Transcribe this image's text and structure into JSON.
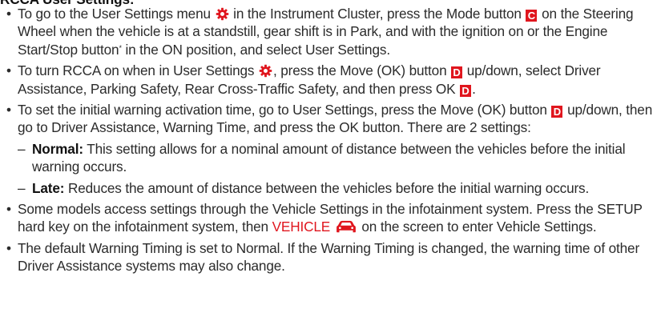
{
  "section": {
    "heading": "RCCA User Settings:"
  },
  "icons": {
    "accent_color": "#e0161e",
    "settings": "gear-icon",
    "vehicle": "car-icon"
  },
  "bullets": {
    "b1": {
      "p1": "To go to the User Settings menu",
      "p2": "in the Instrument Cluster, press the Mode button",
      "key": "C",
      "p3": "on the Steering Wheel when the vehicle is at a standstill, gear shift is in Park, and with the ignition on or the Engine Start/Stop button",
      "asterisk": "*",
      "p4": "in the ON position, and select User Settings."
    },
    "b2": {
      "p1": "To turn RCCA on when in User Settings",
      "p2": ", press the Move (OK) button",
      "key": "D",
      "p3": "up/down, select Driver Assistance, Parking Safety, Rear Cross-Traffic Safety, and then press OK",
      "key2": "D",
      "p4": "."
    },
    "b3": {
      "p1": "To set the initial warning activation time, go to User Settings, press the Move (OK) button",
      "key": "D",
      "p2": "up/down, then go to Driver Assistance, Warning Time, and press the OK button. There are 2 settings:"
    },
    "sub": {
      "normal": {
        "dash": "–",
        "term": "Normal:",
        "text": "This setting allows for a nominal amount of distance between the vehicles before the initial warning occurs."
      },
      "late": {
        "dash": "–",
        "term": "Late:",
        "text": "Reduces the amount of distance between the vehicles before the initial warning occurs."
      }
    },
    "b4": {
      "p1": "Some models access settings through the Vehicle Settings in the infotainment system. Press the SETUP hard key on the infotainment system, then",
      "link": "VEHICLE",
      "p2": "on the screen to enter Vehicle Settings."
    },
    "b5": {
      "text": "The default Warning Timing is set to Normal. If the Warning Timing is changed, the warning time of other Driver Assistance systems may also change."
    }
  }
}
